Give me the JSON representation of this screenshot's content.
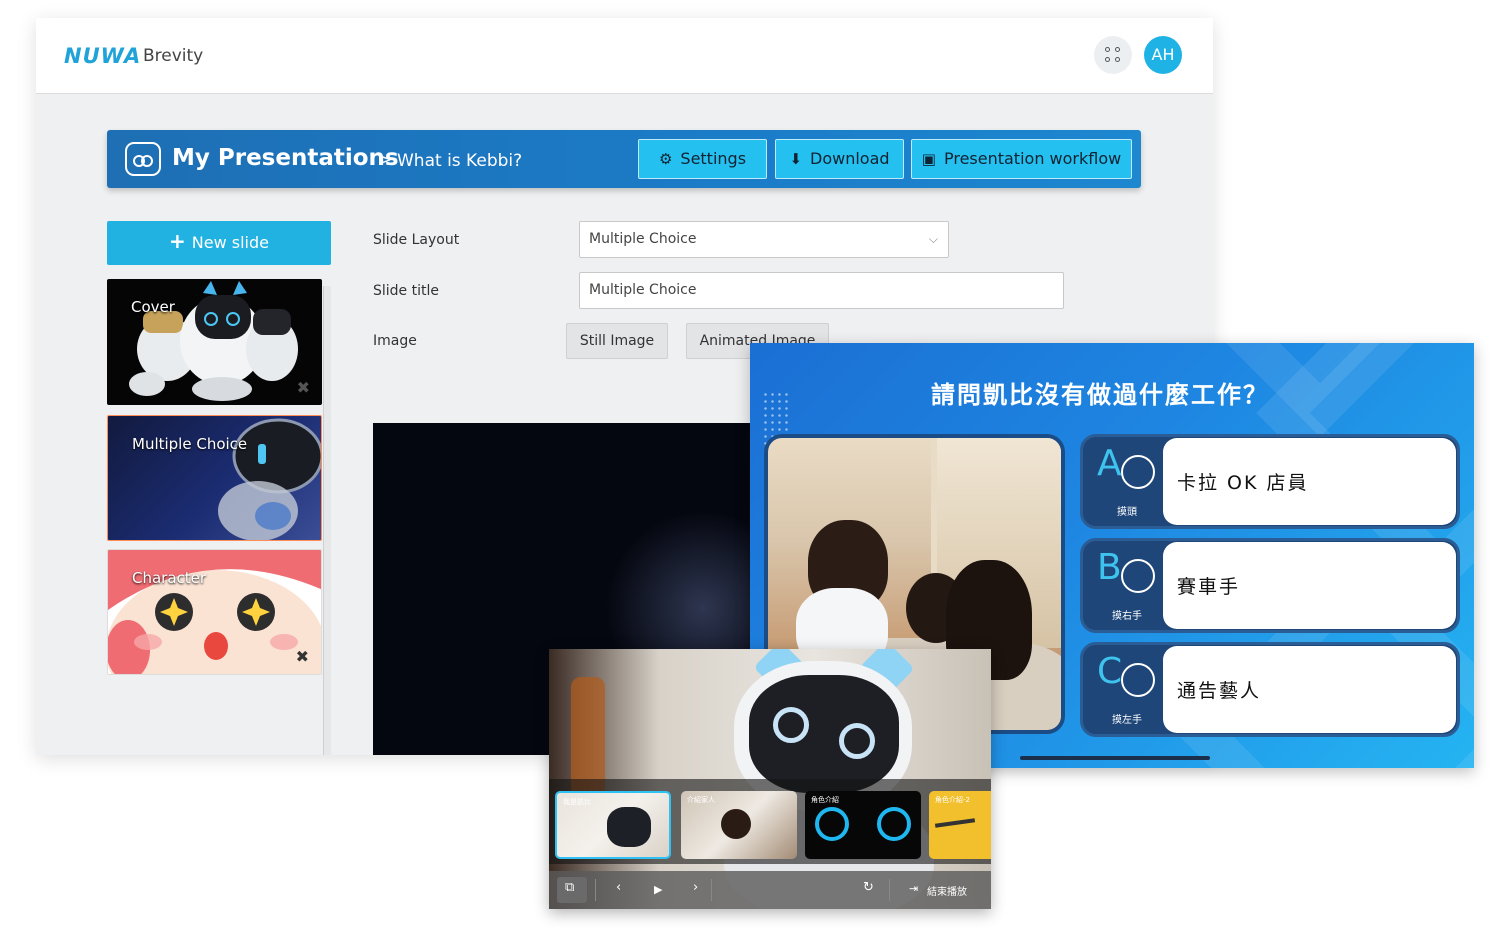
{
  "app": {
    "logo": "NUWA",
    "product": "Brevity",
    "user_initials": "AH"
  },
  "header": {
    "title": "My Presentations",
    "separator": ">",
    "current": "What is Kebbi?",
    "buttons": [
      {
        "label": "Settings",
        "icon": "gear-icon"
      },
      {
        "label": "Download",
        "icon": "download-icon"
      },
      {
        "label": "Presentation workflow",
        "icon": "image-icon"
      }
    ]
  },
  "sidebar": {
    "new_slide_label": "New slide",
    "slides": [
      {
        "label": "Cover"
      },
      {
        "label": "Multiple Choice"
      },
      {
        "label": "Character"
      }
    ]
  },
  "form": {
    "layout_label": "Slide Layout",
    "layout_value": "Multiple Choice",
    "title_label": "Slide title",
    "title_value": "Multiple Choice",
    "image_label": "Image",
    "still_image": "Still Image",
    "animated_image": "Animated Image"
  },
  "quiz": {
    "question": "請問凱比沒有做過什麼工作？",
    "options": [
      {
        "letter": "A",
        "gesture": "摸頭",
        "text": "卡拉 OK 店員"
      },
      {
        "letter": "B",
        "gesture": "摸右手",
        "text": "賽車手"
      },
      {
        "letter": "C",
        "gesture": "摸左手",
        "text": "通告藝人"
      }
    ]
  },
  "player": {
    "thumbs": [
      "我是凱比",
      "介紹家人",
      "角色介紹",
      "角色介紹-2"
    ],
    "exit_label": "結束播放"
  },
  "colors": {
    "accent": "#22b2e2",
    "header_blue": "#1b7cc8",
    "quiz_blue": "#1e87e2"
  }
}
